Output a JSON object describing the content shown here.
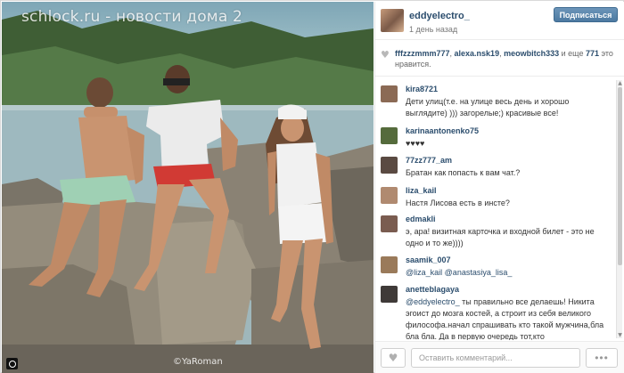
{
  "photo": {
    "watermark": "schlock.ru - новости дома 2",
    "credit": "©YaRoman"
  },
  "post": {
    "username": "eddyelectro_",
    "time_ago": "1 день назад",
    "follow_label": "Подписаться"
  },
  "likes": {
    "users": [
      "fffzzzmmm777",
      "alexa.nsk19",
      "meowbitch333"
    ],
    "sep1": ", ",
    "sep2": ", ",
    "and_more": " и еще ",
    "count": "771",
    "suffix": " это нравится."
  },
  "comments": [
    {
      "user": "kira8721",
      "text": "Дети улиц(т.е. на улице весь день и хорошо выглядите) ))) загорелые;) красивые все!",
      "avatar_color": "#8b6a55"
    },
    {
      "user": "karinaantonenko75",
      "text": "♥♥♥♥",
      "avatar_color": "#556b3c"
    },
    {
      "user": "77zz777_am",
      "text": "Братан как попасть к вам чат.?",
      "avatar_color": "#5a4a42"
    },
    {
      "user": "liza_kail",
      "text": "Настя Лисова есть в инсте?",
      "avatar_color": "#b08a70"
    },
    {
      "user": "edmakli",
      "text": "э, ара! визитная карточка и входной билет - это не одно и то же))))",
      "avatar_color": "#7a5c50"
    },
    {
      "user": "saamik_007",
      "mention1": "@liza_kail",
      "mention2": "@anastasiya_lisa_",
      "avatar_color": "#9a7a5a"
    },
    {
      "user": "anetteblagaya",
      "mention": "@eddyelectro_",
      "text": " ты правильно все делаешь! Никита эгоист до мозга костей, а строит из себя великого философа.начал спрашивать кто такой мужчина,бла бла бла. Да в первую очередь тот,кто",
      "avatar_color": "#3f3a38"
    }
  ],
  "footer": {
    "comment_placeholder": "Оставить комментарий...",
    "more_label": "•••"
  },
  "icons": {
    "like": "heart-icon",
    "more": "ellipsis-icon",
    "brand": "instagram-icon"
  },
  "colors": {
    "link": "#2b4d6d",
    "follow_button": "#5a86ad"
  }
}
